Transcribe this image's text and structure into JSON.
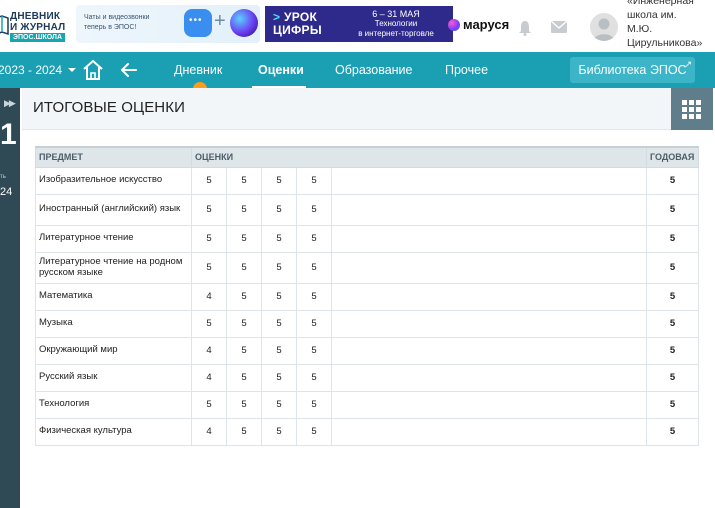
{
  "header": {
    "logo": {
      "line1": "ДНЕВНИК",
      "line2": "И ЖУРНАЛ",
      "badge": "ЭПОС.ШКОЛА"
    },
    "promo_chat": {
      "text": "Чаты и видеозвонки теперь в ЭПОС!"
    },
    "promo_urok": {
      "title_line1": "УРОК",
      "title_line2": "ЦИФРЫ",
      "dates": "6 – 31 МАЯ",
      "subtitle_line1": "Технологии",
      "subtitle_line2": "в интернет-торговле"
    },
    "marusya": "маруся",
    "school_lines": [
      "«Инженерная",
      "школа им.",
      "М.Ю.",
      "Цирульникова»"
    ]
  },
  "nav": {
    "year": "2023 - 2024",
    "items": [
      {
        "label": "Дневник"
      },
      {
        "label": "Оценки"
      },
      {
        "label": "Образование"
      },
      {
        "label": "Прочее"
      }
    ],
    "library_button": "Библиотека ЭПОС",
    "library_icon": "external-link-icon"
  },
  "rail": {
    "big": "1",
    "small": "ть",
    "year": "24"
  },
  "page": {
    "title": "ИТОГОВЫЕ ОЦЕНКИ"
  },
  "table": {
    "headers": {
      "subject": "ПРЕДМЕТ",
      "grades": "ОЦЕНКИ",
      "year": "ГОДОВАЯ"
    },
    "rows": [
      {
        "subject": "Изобразительное искусство",
        "grades": [
          "5",
          "5",
          "5",
          "5"
        ],
        "year": "5"
      },
      {
        "subject": "Иностранный (английский) язык",
        "grades": [
          "5",
          "5",
          "5",
          "5"
        ],
        "year": "5"
      },
      {
        "subject": "Литературное чтение",
        "grades": [
          "5",
          "5",
          "5",
          "5"
        ],
        "year": "5"
      },
      {
        "subject": "Литературное чтение на родном русском языке",
        "grades": [
          "5",
          "5",
          "5",
          "5"
        ],
        "year": "5"
      },
      {
        "subject": "Математика",
        "grades": [
          "4",
          "5",
          "5",
          "5"
        ],
        "year": "5"
      },
      {
        "subject": "Музыка",
        "grades": [
          "5",
          "5",
          "5",
          "5"
        ],
        "year": "5"
      },
      {
        "subject": "Окружающий мир",
        "grades": [
          "4",
          "5",
          "5",
          "5"
        ],
        "year": "5"
      },
      {
        "subject": "Русский язык",
        "grades": [
          "4",
          "5",
          "5",
          "5"
        ],
        "year": "5"
      },
      {
        "subject": "Технология",
        "grades": [
          "5",
          "5",
          "5",
          "5"
        ],
        "year": "5"
      },
      {
        "subject": "Физическая культура",
        "grades": [
          "4",
          "5",
          "5",
          "5"
        ],
        "year": "5"
      }
    ]
  },
  "colors": {
    "nav": "#1a9fb3",
    "rail": "#2f4a55",
    "accent_dot": "#ff9a1a",
    "grid_button": "#607d8b"
  }
}
